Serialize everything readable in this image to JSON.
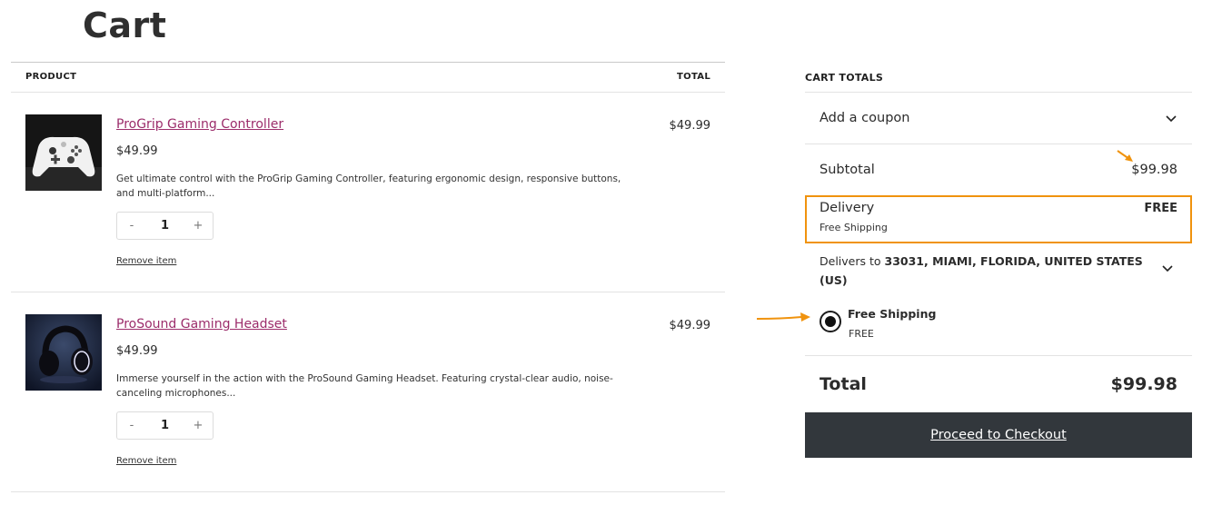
{
  "page": {
    "title": "Cart"
  },
  "table": {
    "col_product": "PRODUCT",
    "col_total": "TOTAL"
  },
  "items": [
    {
      "name": "ProGrip Gaming Controller",
      "price": "$49.99",
      "description": "Get ultimate control with the ProGrip Gaming Controller, featuring ergonomic design, responsive buttons, and multi-platform...",
      "quantity": "1",
      "qty_minus": "-",
      "qty_plus": "+",
      "remove_label": "Remove item",
      "line_total": "$49.99",
      "image": "gaming-controller-photo"
    },
    {
      "name": "ProSound Gaming Headset",
      "price": "$49.99",
      "description": "Immerse yourself in the action with the ProSound Gaming Headset. Featuring crystal-clear audio, noise-canceling microphones...",
      "quantity": "1",
      "qty_minus": "-",
      "qty_plus": "+",
      "remove_label": "Remove item",
      "line_total": "$49.99",
      "image": "gaming-headset-photo"
    }
  ],
  "totals": {
    "title": "CART TOTALS",
    "coupon_label": "Add a coupon",
    "subtotal_label": "Subtotal",
    "subtotal_value": "$99.98",
    "delivery_label": "Delivery",
    "delivery_value": "FREE",
    "delivery_method": "Free Shipping",
    "delivers_to_prefix": "Delivers to",
    "delivers_to_address": "33031, MIAMI, FLORIDA, UNITED STATES (US)",
    "shipping_option_name": "Free Shipping",
    "shipping_option_price": "FREE",
    "total_label": "Total",
    "total_value": "$99.98",
    "checkout_label": "Proceed to Checkout"
  },
  "colors": {
    "link": "#9c2d6b",
    "highlight": "#f0930e",
    "button_bg": "#32373c"
  },
  "icons": [
    "chevron-down-icon",
    "radio-selected-icon",
    "annotation-arrow-icon"
  ]
}
